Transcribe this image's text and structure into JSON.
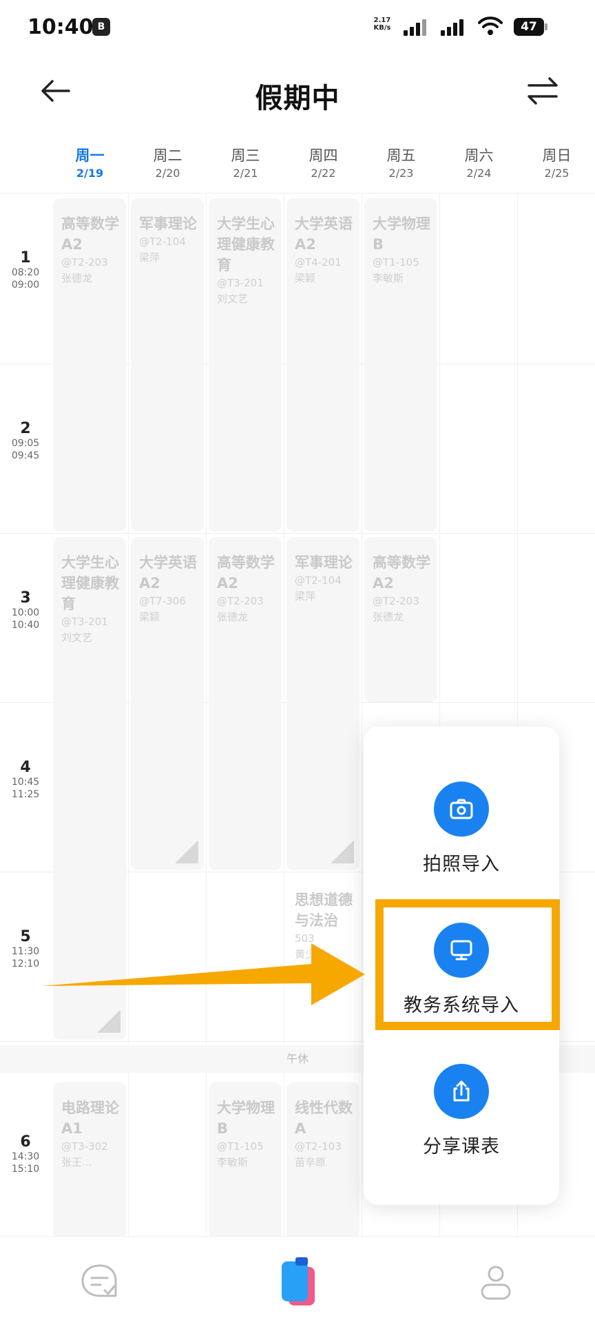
{
  "status_bar": {
    "time": "10:40",
    "notification_badge": "B",
    "speed_value": "2.17",
    "speed_unit": "KB/s",
    "battery": "47"
  },
  "header": {
    "title": "假期中",
    "back_icon": "arrow-left-icon",
    "switch_icon": "swap-arrows-icon"
  },
  "days": [
    {
      "name": "周一",
      "date": "2/19",
      "active": true
    },
    {
      "name": "周二",
      "date": "2/20"
    },
    {
      "name": "周三",
      "date": "2/21"
    },
    {
      "name": "周四",
      "date": "2/22"
    },
    {
      "name": "周五",
      "date": "2/23"
    },
    {
      "name": "周六",
      "date": "2/24"
    },
    {
      "name": "周日",
      "date": "2/25"
    }
  ],
  "periods": [
    {
      "num": "1",
      "start": "08:20",
      "end": "09:00"
    },
    {
      "num": "2",
      "start": "09:05",
      "end": "09:45"
    },
    {
      "num": "3",
      "start": "10:00",
      "end": "10:40"
    },
    {
      "num": "4",
      "start": "10:45",
      "end": "11:25"
    },
    {
      "num": "5",
      "start": "11:30",
      "end": "12:10"
    },
    {
      "num": "6",
      "start": "14:30",
      "end": "15:10"
    }
  ],
  "courses": [
    {
      "name": "高等数学A2",
      "loc": "@T2-203",
      "teacher": "张德龙"
    },
    {
      "name": "军事理论",
      "loc": "@T2-104",
      "teacher": "梁萍"
    },
    {
      "name": "大学生心理健康教育",
      "loc": "@T3-201",
      "teacher": "刘文艺"
    },
    {
      "name": "大学英语A2",
      "loc": "@T4-201",
      "teacher": "梁颖"
    },
    {
      "name": "大学物理B",
      "loc": "@T1-105",
      "teacher": "李敏斯"
    },
    {
      "name": "大学生心理健康教育",
      "loc": "@T3-201",
      "teacher": "刘文艺"
    },
    {
      "name": "大学英语A2",
      "loc": "@T7-306",
      "teacher": "梁颖"
    },
    {
      "name": "高等数学A2",
      "loc": "@T2-203",
      "teacher": "张德龙"
    },
    {
      "name": "军事理论",
      "loc": "@T2-104",
      "teacher": "梁萍"
    },
    {
      "name": "高等数学A2",
      "loc": "@T2-203",
      "teacher": "张德龙"
    },
    {
      "name": "思想道德与法治",
      "loc": "503",
      "teacher": "黄少洪"
    },
    {
      "name": "电路理论A1",
      "loc": "@T3-302",
      "teacher": "张王..."
    },
    {
      "name": "大学物理B",
      "loc": "@T1-105",
      "teacher": "李敏斯"
    },
    {
      "name": "线性代数A",
      "loc": "@T2-103",
      "teacher": "苗辛原"
    }
  ],
  "lunch_label": "午休",
  "popup": {
    "items": [
      {
        "label": "拍照导入",
        "icon": "camera-icon"
      },
      {
        "label": "教务系统导入",
        "icon": "monitor-icon"
      },
      {
        "label": "分享课表",
        "icon": "share-icon"
      }
    ]
  },
  "annotation": {
    "highlight_color": "#f6a800"
  },
  "colors": {
    "accent": "#1a82f0",
    "active_day": "#1677e8"
  },
  "bottom_nav": [
    {
      "icon": "chat-check-icon"
    },
    {
      "icon": "books-icon"
    },
    {
      "icon": "user-icon"
    }
  ]
}
